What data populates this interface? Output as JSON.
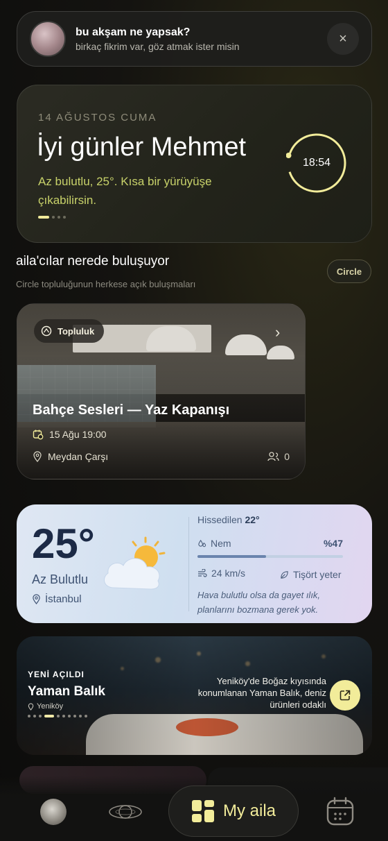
{
  "notification": {
    "title": "bu akşam ne yapsak?",
    "subtitle": "birkaç fikrim var, göz atmak ister misin",
    "close_icon": "×"
  },
  "hero": {
    "date": "14 AĞUSTOS CUMA",
    "greeting": "İyi günler Mehmet",
    "subtitle": "Az bulutlu, 25°. Kısa bir yürüyüşe çıkabilirsin.",
    "time": "18:54",
    "pager": {
      "count": 4,
      "active": 0
    }
  },
  "meetups": {
    "title": "aila'cılar nerede buluşuyor",
    "subtitle": "Circle topluluğunun herkese açık buluşmaları",
    "circle_button": "Circle"
  },
  "event": {
    "badge": "Topluluk",
    "title": "Bahçe Sesleri — Yaz Kapanışı",
    "datetime": "15 Ağu 19:00",
    "location": "Meydan Çarşı",
    "attendees": "0"
  },
  "weather": {
    "temperature": "25°",
    "condition": "Az Bulutlu",
    "city": "İstanbul",
    "feels_label": "Hissedilen",
    "feels_value": "22°",
    "humidity_label": "Nem",
    "humidity_value": "%47",
    "humidity_fraction": 0.47,
    "wind": "24 km/s",
    "clothing": "Tişört yeter",
    "note": "Hava bulutlu olsa da gayet ılık, planlarını bozmana gerek yok."
  },
  "promo": {
    "kicker": "YENİ AÇILDI",
    "title": "Yaman Balık",
    "location": "Yeniköy",
    "description": "Yeniköy'de Boğaz kıyısında konumlanan Yaman Balık, deniz ürünleri odaklı",
    "pager": {
      "count": 10,
      "active": 3
    }
  },
  "tabbar": {
    "myaila_label": "My aila"
  },
  "colors": {
    "accent": "#f2ec9a",
    "hero_subtitle": "#c8d26a",
    "background": "#121211"
  },
  "icons": [
    "close-icon",
    "community-icon",
    "chevron-right-icon",
    "calendar-clock-icon",
    "location-pin-icon",
    "people-icon",
    "humidity-icon",
    "wind-icon",
    "leaf-icon",
    "external-link-icon",
    "orbit-icon",
    "grid-icon",
    "calendar-icon"
  ]
}
